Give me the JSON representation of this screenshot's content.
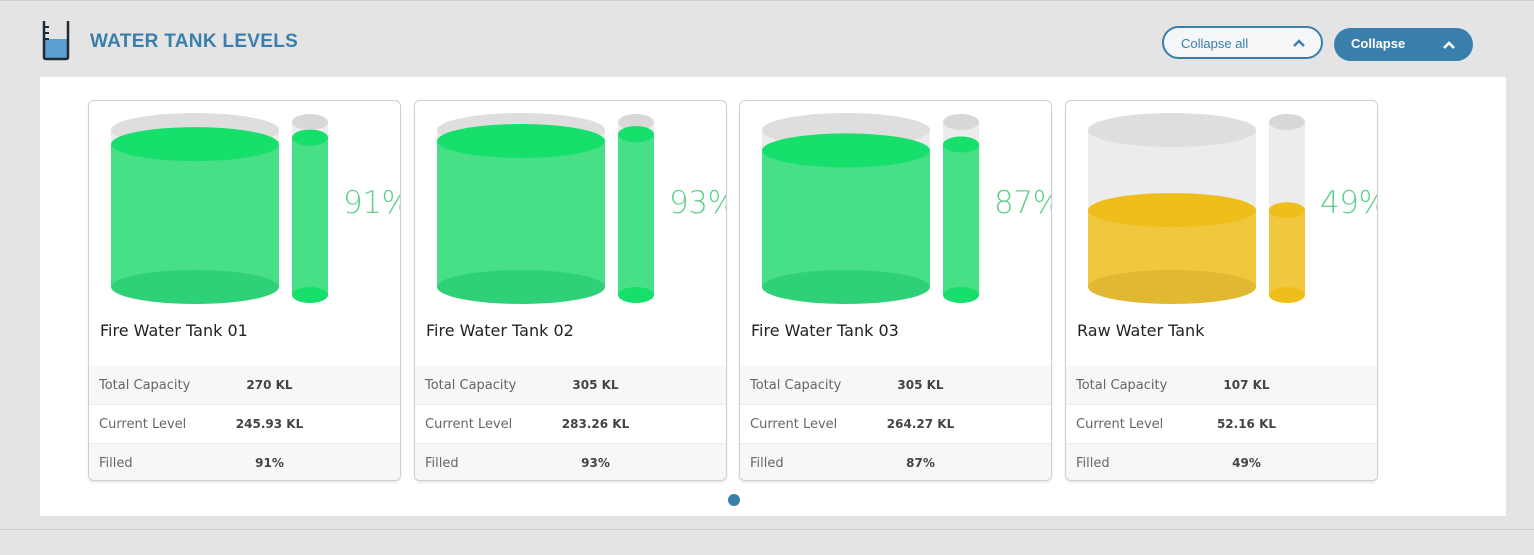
{
  "header": {
    "title": "WATER TANK LEVELS",
    "icon": "water-beaker-icon",
    "collapse_all_label": "Collapse all",
    "collapse_label": "Collapse"
  },
  "colors": {
    "accent": "#3a7fab",
    "fill_green": "#47e087",
    "fill_yellow": "#f0c435",
    "empty_gray": "#e2e2e2"
  },
  "tanks": [
    {
      "name": "Fire Water Tank 01",
      "percent_text": "91%",
      "fill_fraction": 0.91,
      "color": "green",
      "rows": [
        {
          "label": "Total Capacity",
          "value": "270 KL"
        },
        {
          "label": "Current Level",
          "value": "245.93 KL"
        },
        {
          "label": "Filled",
          "value": "91%"
        }
      ]
    },
    {
      "name": "Fire Water Tank 02",
      "percent_text": "93%",
      "fill_fraction": 0.93,
      "color": "green",
      "rows": [
        {
          "label": "Total Capacity",
          "value": "305 KL"
        },
        {
          "label": "Current Level",
          "value": "283.26 KL"
        },
        {
          "label": "Filled",
          "value": "93%"
        }
      ]
    },
    {
      "name": "Fire Water Tank 03",
      "percent_text": "87%",
      "fill_fraction": 0.87,
      "color": "green",
      "rows": [
        {
          "label": "Total Capacity",
          "value": "305 KL"
        },
        {
          "label": "Current Level",
          "value": "264.27 KL"
        },
        {
          "label": "Filled",
          "value": "87%"
        }
      ]
    },
    {
      "name": "Raw Water Tank",
      "percent_text": "49%",
      "fill_fraction": 0.49,
      "color": "yellow",
      "rows": [
        {
          "label": "Total Capacity",
          "value": "107 KL"
        },
        {
          "label": "Current Level",
          "value": "52.16 KL"
        },
        {
          "label": "Filled",
          "value": "49%"
        }
      ]
    }
  ],
  "pagination": {
    "pages": 1,
    "active": 1
  }
}
